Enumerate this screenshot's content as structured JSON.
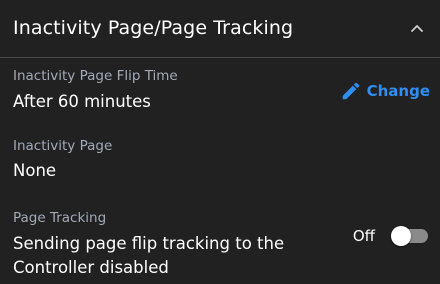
{
  "header": {
    "title": "Inactivity Page/Page Tracking",
    "collapse_icon": "chevron-up-icon"
  },
  "flip_time": {
    "label": "Inactivity Page Flip Time",
    "value": "After 60 minutes",
    "action_label": "Change",
    "action_icon": "pencil-icon"
  },
  "inactivity_page": {
    "label": "Inactivity Page",
    "value": "None"
  },
  "page_tracking": {
    "label": "Page Tracking",
    "value": "Sending page flip tracking to the Controller disabled",
    "toggle_state": "Off",
    "toggle_on": false
  },
  "colors": {
    "background": "#212121",
    "label": "#a3aab8",
    "accent": "#2f8ff0",
    "toggle_track_off": "#8a8a8a"
  }
}
